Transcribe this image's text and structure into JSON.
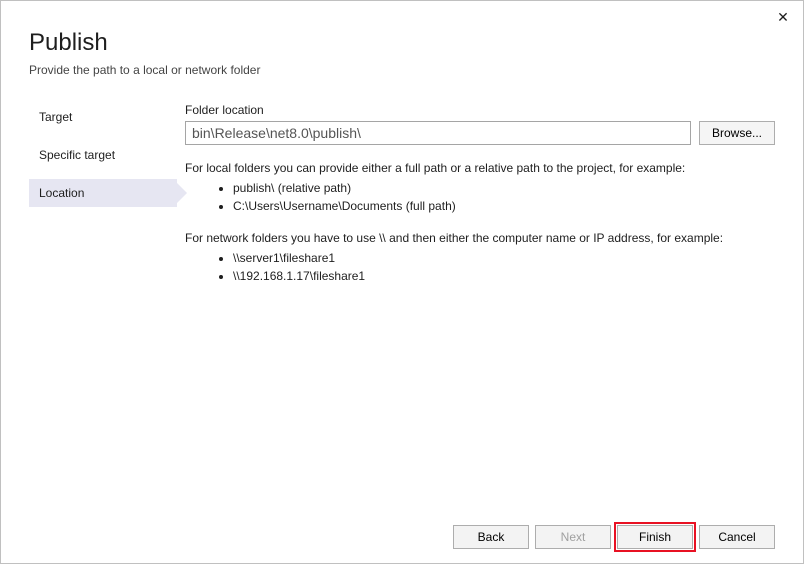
{
  "close": "✕",
  "header": {
    "title": "Publish",
    "subtitle": "Provide the path to a local or network folder"
  },
  "sidebar": {
    "items": [
      {
        "label": "Target"
      },
      {
        "label": "Specific target"
      },
      {
        "label": "Location"
      }
    ]
  },
  "content": {
    "folder_label": "Folder location",
    "folder_value": "bin\\Release\\net8.0\\publish\\",
    "browse_label": "Browse...",
    "help_local_intro": "For local folders you can provide either a full path or a relative path to the project, for example:",
    "help_local_ex1": "publish\\ (relative path)",
    "help_local_ex2": "C:\\Users\\Username\\Documents (full path)",
    "help_net_intro": "For network folders you have to use \\\\ and then either the computer name or IP address, for example:",
    "help_net_ex1": "\\\\server1\\fileshare1",
    "help_net_ex2": "\\\\192.168.1.17\\fileshare1"
  },
  "footer": {
    "back": "Back",
    "next": "Next",
    "finish": "Finish",
    "cancel": "Cancel"
  }
}
